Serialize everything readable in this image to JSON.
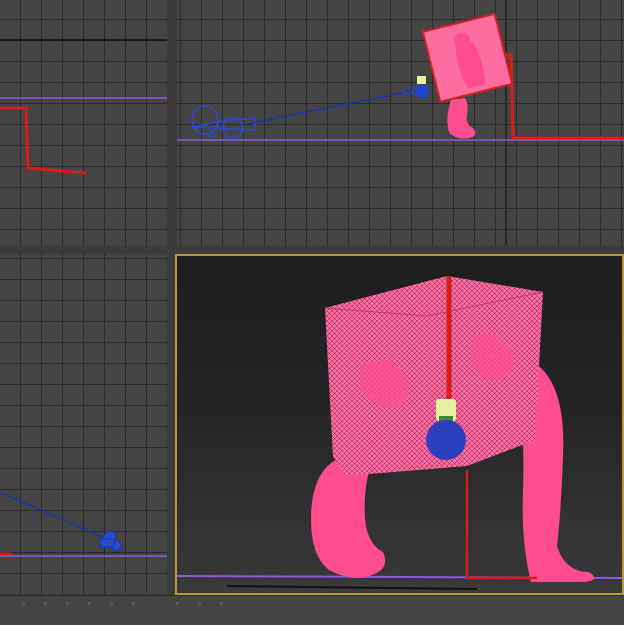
{
  "viewports": [
    {
      "id": "top-left",
      "active": false
    },
    {
      "id": "top-right",
      "active": false
    },
    {
      "id": "bottom-left",
      "active": false
    },
    {
      "id": "perspective",
      "active": true
    }
  ],
  "colors": {
    "grid_bg": "#454545",
    "grid_line": "#2b2b2b",
    "active_border": "#b89a3a",
    "spline_red": "#d81c1c",
    "ground_purple": "#8a5ad8",
    "character_pink": "#ff4d8d",
    "camera_blue": "#2a4ad0",
    "bulb_blue": "#2244cc",
    "bulb_base": "#e8f0a0"
  },
  "objects": [
    "lamp-cube",
    "cord-spline",
    "light-bulb",
    "camera",
    "ground-line"
  ]
}
